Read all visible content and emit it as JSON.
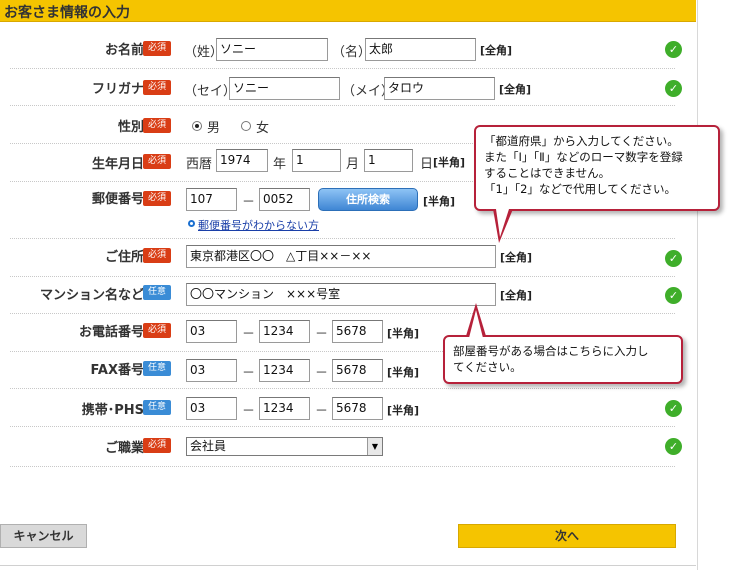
{
  "header": {
    "title": "お客さま情報の入力"
  },
  "badges": {
    "required": "必須",
    "optional": "任意"
  },
  "rows": {
    "name": {
      "label": "お名前",
      "sei_prefix": "（姓）",
      "sei_value": "ソニー",
      "mei_prefix": "（名）",
      "mei_value": "太郎",
      "note": "[全角]"
    },
    "kana": {
      "label": "フリガナ",
      "sei_prefix": "（セイ）",
      "sei_value": "ソニー",
      "mei_prefix": "（メイ）",
      "mei_value": "タロウ",
      "note": "[全角]"
    },
    "gender": {
      "label": "性別",
      "options": [
        "男",
        "女"
      ],
      "selected": "男"
    },
    "birthday": {
      "label": "生年月日",
      "era": "西暦",
      "year": "1974",
      "year_unit": "年",
      "month": "1",
      "month_unit": "月",
      "day": "1",
      "day_unit": "日",
      "note": "[半角]"
    },
    "postal": {
      "label": "郵便番号",
      "first": "107",
      "dash": "－",
      "second": "0052",
      "search_button": "住所検索",
      "note": "[半角]",
      "help_link": "郵便番号がわからない方"
    },
    "address": {
      "label": "ご住所",
      "value": "東京都港区〇〇　△丁目××－××",
      "note": "[全角]"
    },
    "building": {
      "label": "マンション名など",
      "value": "〇〇マンション　×××号室",
      "note": "[全角]"
    },
    "phone": {
      "label": "お電話番号",
      "p1": "03",
      "p2": "1234",
      "p3": "5678",
      "dash": "－",
      "note": "[半角]"
    },
    "fax": {
      "label": "FAX番号",
      "p1": "03",
      "p2": "1234",
      "p3": "5678",
      "dash": "－",
      "note": "[半角]"
    },
    "mobile": {
      "label": "携帯･PHS",
      "p1": "03",
      "p2": "1234",
      "p3": "5678",
      "dash": "－",
      "note": "[半角]"
    },
    "job": {
      "label": "ご職業",
      "selected": "会社員"
    }
  },
  "tooltips": {
    "address_hint": "「都道府県」から入力してください。\nまた「Ⅰ」「Ⅱ」などのローマ数字を登録\nすることはできません。\n「1」「2」などで代用してください。",
    "building_hint": "部屋番号がある場合はこちらに入力し\nてください。"
  },
  "buttons": {
    "cancel": "キャンセル",
    "next": "次へ"
  },
  "colors": {
    "accent": "#f5c400",
    "required_badge": "#d93d15",
    "optional_badge": "#3a8cd6",
    "valid_check": "#3fae2a",
    "tooltip_border": "#b6213a"
  },
  "icons": {
    "valid": "check-circle-icon",
    "link_bullet": "circle-bullet-icon",
    "select_arrow": "chevron-down-icon"
  }
}
